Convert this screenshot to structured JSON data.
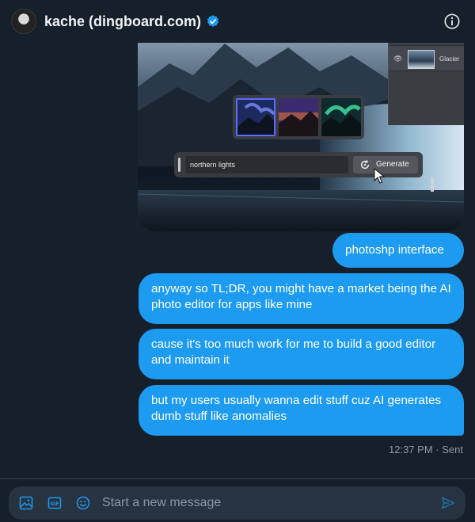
{
  "header": {
    "name": "kache (dingboard.com)",
    "verified_icon": "verified-badge-icon",
    "info_icon": "info-icon"
  },
  "image_message": {
    "ps_layer_label": "Glacier",
    "prompt_text": "northern lights",
    "generate_label": "Generate"
  },
  "messages": [
    {
      "text": "photoshp interface"
    },
    {
      "text": "anyway so TL;DR, you might have a market being the AI photo editor for apps like mine"
    },
    {
      "text": "cause it's too much work for me to build a good editor and maintain it"
    },
    {
      "text": "but my users usually wanna edit stuff cuz AI generates dumb stuff like anomalies"
    }
  ],
  "meta": {
    "time": "12:37 PM",
    "separator": "·",
    "status": "Sent"
  },
  "composer": {
    "placeholder": "Start a new message",
    "icons": [
      "media-icon",
      "gif-icon",
      "emoji-icon",
      "send-icon"
    ]
  },
  "colors": {
    "background": "#15202b",
    "bubble": "#1d9bf0",
    "accent": "#1d9bf0",
    "muted_text": "#8b98a5"
  }
}
